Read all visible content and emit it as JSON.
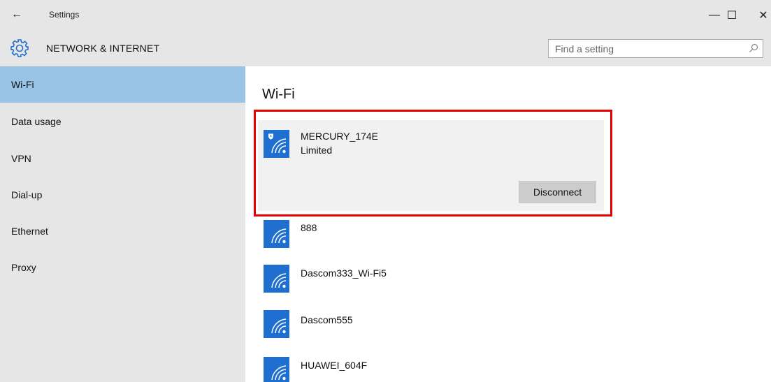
{
  "window": {
    "title": "Settings",
    "back_glyph": "←",
    "minimize_glyph": "—",
    "maximize_glyph": "☐",
    "close_glyph": "✕"
  },
  "header": {
    "section_title": "NETWORK & INTERNET",
    "search_placeholder": "Find a setting"
  },
  "sidebar": {
    "items": [
      {
        "label": "Wi-Fi",
        "active": true
      },
      {
        "label": "Data usage",
        "active": false
      },
      {
        "label": "VPN",
        "active": false
      },
      {
        "label": "Dial-up",
        "active": false
      },
      {
        "label": "Ethernet",
        "active": false
      },
      {
        "label": "Proxy",
        "active": false
      }
    ]
  },
  "main": {
    "title": "Wi-Fi",
    "connected_network": {
      "name": "MERCURY_174E",
      "status": "Limited",
      "secured": true,
      "disconnect_label": "Disconnect"
    },
    "networks": [
      {
        "name": "888"
      },
      {
        "name": "Dascom333_Wi-Fi5"
      },
      {
        "name": "Dascom555"
      },
      {
        "name": "HUAWEI_604F"
      }
    ]
  },
  "colors": {
    "accent": "#1f6fd1",
    "nav_active": "#99c4e8",
    "chrome": "#e6e6e6",
    "highlight_border": "#e60000"
  }
}
